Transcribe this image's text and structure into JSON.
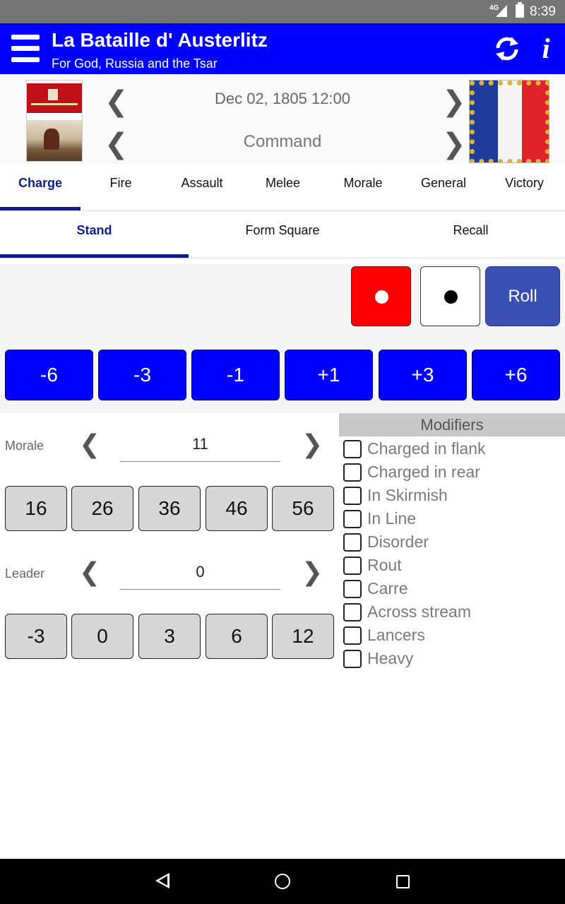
{
  "status_bar": {
    "network": "4G",
    "time": "8:39"
  },
  "app_bar": {
    "title": "La Bataille d' Austerlitz",
    "subtitle": "For God, Russia and the Tsar",
    "info_label": "i"
  },
  "header": {
    "date": "Dec 02, 1805 12:00",
    "phase": "Command",
    "prev_arrow": "❮",
    "next_arrow": "❯"
  },
  "tabs": [
    "Charge",
    "Fire",
    "Assault",
    "Melee",
    "Morale",
    "General",
    "Victory"
  ],
  "subtabs": [
    "Stand",
    "Form Square",
    "Recall"
  ],
  "dice": [
    {
      "color": "#ff0000",
      "pip": "#ffffff"
    },
    {
      "color": "#ffffff",
      "pip": "#000000"
    }
  ],
  "roll_label": "Roll",
  "modifier_buttons": [
    "-6",
    "-3",
    "-1",
    "+1",
    "+3",
    "+6"
  ],
  "morale": {
    "label": "Morale",
    "value": "11",
    "options": [
      "16",
      "26",
      "36",
      "46",
      "56"
    ]
  },
  "leader": {
    "label": "Leader",
    "value": "0",
    "options": [
      "-3",
      "0",
      "3",
      "6",
      "12"
    ]
  },
  "modifiers": {
    "title": "Modifiers",
    "items": [
      {
        "label": "Charged in flank",
        "checked": false
      },
      {
        "label": "Charged in rear",
        "checked": false
      },
      {
        "label": "In Skirmish",
        "checked": false
      },
      {
        "label": "In Line",
        "checked": false
      },
      {
        "label": "Disorder",
        "checked": false
      },
      {
        "label": "Rout",
        "checked": false
      },
      {
        "label": "Carre",
        "checked": false
      },
      {
        "label": "Across stream",
        "checked": false
      },
      {
        "label": "Lancers",
        "checked": false
      },
      {
        "label": "Heavy",
        "checked": false
      }
    ]
  },
  "colors": {
    "app_bar": "#0000ff",
    "accent": "#0d1c8a",
    "roll_button": "#3a4fb4",
    "modifier_button": "#0000ff"
  }
}
